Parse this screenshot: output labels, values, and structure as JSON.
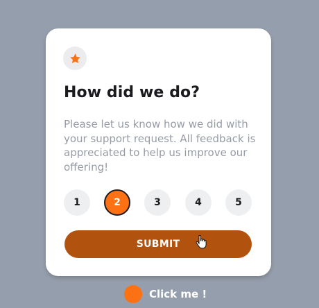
{
  "colors": {
    "background": "#959eac",
    "card": "#ffffff",
    "accent": "#fc7114",
    "submit": "#b2520f",
    "badge": "#ececee",
    "title": "#1b1b1f",
    "description": "#969ba6"
  },
  "card": {
    "icon": "star-icon",
    "title": "How did we do?",
    "description": "Please let us know how we did with your support request. All feedback is appreciated to help us improve our offering!",
    "ratings": [
      {
        "label": "1",
        "selected": false
      },
      {
        "label": "2",
        "selected": true
      },
      {
        "label": "3",
        "selected": false
      },
      {
        "label": "4",
        "selected": false
      },
      {
        "label": "5",
        "selected": false
      }
    ],
    "submit_label": "SUBMIT"
  },
  "footer": {
    "click_label": "Click me !"
  }
}
